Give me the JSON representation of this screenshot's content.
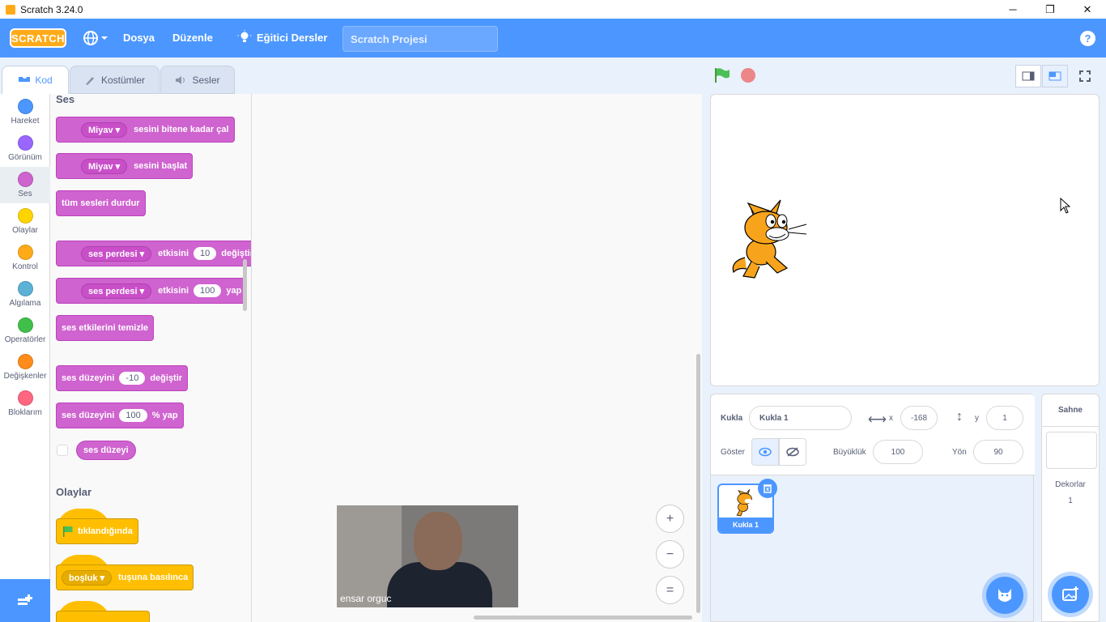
{
  "window": {
    "title": "Scratch 3.24.0",
    "minimize": "─",
    "maximize": "❐",
    "close": "✕"
  },
  "menu": {
    "logo": "SCRATCH",
    "file": "Dosya",
    "edit": "Düzenle",
    "tutorials": "Eğitici Dersler",
    "project_title": "Scratch Projesi",
    "help": "?"
  },
  "tabs": [
    {
      "label": "Kod"
    },
    {
      "label": "Kostümler"
    },
    {
      "label": "Sesler"
    }
  ],
  "categories": [
    {
      "label": "Hareket",
      "color": "#4c97ff"
    },
    {
      "label": "Görünüm",
      "color": "#9966ff"
    },
    {
      "label": "Ses",
      "color": "#cf63cf"
    },
    {
      "label": "Olaylar",
      "color": "#ffd500"
    },
    {
      "label": "Kontrol",
      "color": "#ffab19"
    },
    {
      "label": "Algılama",
      "color": "#5cb1d6"
    },
    {
      "label": "Operatörler",
      "color": "#40bf4a"
    },
    {
      "label": "Değişkenler",
      "color": "#ff8c1a"
    },
    {
      "label": "Bloklarım",
      "color": "#ff6680"
    }
  ],
  "palette": {
    "sound_title": "Ses",
    "b1": {
      "dd": "Miyav",
      "text": "sesini bitene kadar çal"
    },
    "b2": {
      "dd": "Miyav",
      "text": "sesini başlat"
    },
    "b3": {
      "text": "tüm sesleri durdur"
    },
    "b4": {
      "dd": "ses perdesi",
      "pre": "etkisini",
      "num": "10",
      "post": "değiştir"
    },
    "b5": {
      "dd": "ses perdesi",
      "pre": "etkisini",
      "num": "100",
      "post": "yap"
    },
    "b6": {
      "text": "ses etkilerini temizle"
    },
    "b7": {
      "pre": "ses düzeyini",
      "num": "-10",
      "post": "değiştir"
    },
    "b8": {
      "pre": "ses düzeyini",
      "num": "100",
      "post": "% yap"
    },
    "b9": {
      "text": "ses düzeyi"
    },
    "events_title": "Olaylar",
    "e1": {
      "text": "tıklandığında"
    },
    "e2": {
      "dd": "boşluk",
      "text": "tuşuna basılınca"
    }
  },
  "zoom": {
    "in": "+",
    "out": "−",
    "reset": "="
  },
  "webcam": {
    "name": "ensar orguc"
  },
  "sprite_info": {
    "sprite_label": "Kukla",
    "sprite_name": "Kukla 1",
    "x_label": "x",
    "x_value": "-168",
    "y_label": "y",
    "y_value": "1",
    "show_label": "Göster",
    "size_label": "Büyüklük",
    "size_value": "100",
    "direction_label": "Yön",
    "direction_value": "90"
  },
  "sprites": [
    {
      "name": "Kukla 1"
    }
  ],
  "stage_panel": {
    "title": "Sahne",
    "backdrops_label": "Dekorlar",
    "backdrops_count": "1"
  }
}
